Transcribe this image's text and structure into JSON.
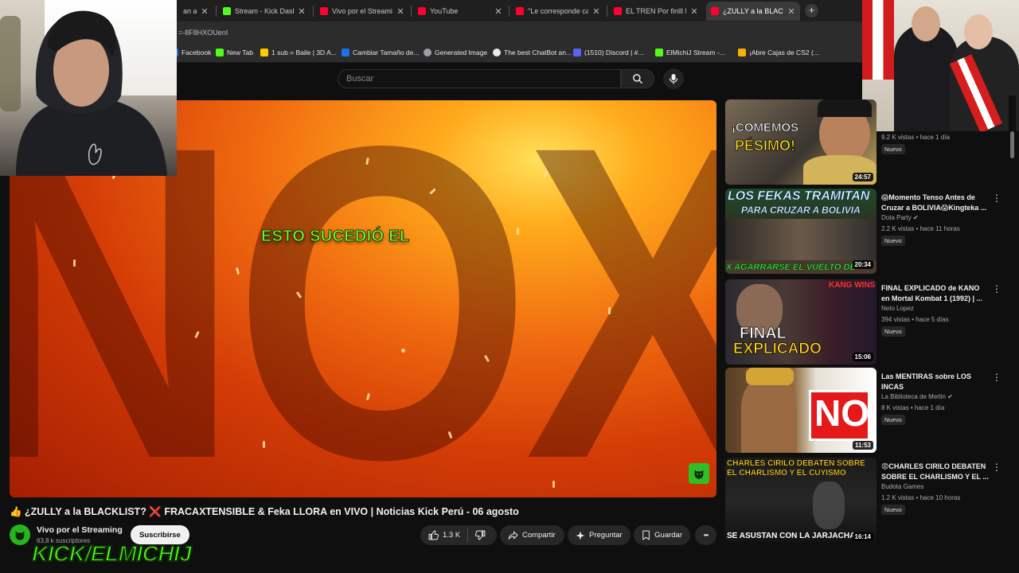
{
  "tabs": [
    {
      "label": "an a DI",
      "favicon_color": "#ff3333",
      "active": false
    },
    {
      "label": "Stream - Kick Dashbo",
      "favicon_color": "#53fc18",
      "active": false
    },
    {
      "label": "Vivo por el Streaming",
      "favicon_color": "#ff0033",
      "active": false
    },
    {
      "label": "YouTube",
      "favicon_color": "#ff0033",
      "active": false
    },
    {
      "label": "\"Le corresponde cad",
      "favicon_color": "#ff0033",
      "active": false
    },
    {
      "label": "EL TREN Por finlll Es",
      "favicon_color": "#ff0033",
      "active": false
    },
    {
      "label": "¿ZULLY a la BLAC",
      "favicon_color": "#ff0033",
      "active": true
    }
  ],
  "url_fragment": "=-8F8HXOUenI",
  "bookmarks": [
    {
      "label": "Facebook",
      "icon_color": "#1877f2"
    },
    {
      "label": "New Tab",
      "icon_color": "#53fc18"
    },
    {
      "label": "1 sub = Baile | 3D A...",
      "icon_color": "#ffcc00"
    },
    {
      "label": "Cambiar Tamaño de...",
      "icon_color": "#1a73e8"
    },
    {
      "label": "Generated Image",
      "icon_color": "#9aa0a6"
    },
    {
      "label": "The best ChatBot an...",
      "icon_color": "#e8eaed"
    },
    {
      "label": "(1510) Discord | #...",
      "icon_color": "#5865f2"
    },
    {
      "label": "ElMichiJ Stream -...",
      "icon_color": "#53fc18"
    },
    {
      "label": "¡Abre Cajas de CS2 (...",
      "icon_color": "#f4b400"
    }
  ],
  "search": {
    "placeholder": "Buscar"
  },
  "video": {
    "overlay_text": "ESTO SUCEDIÓ EL",
    "background_letters": "NOXE",
    "title": "👍 ¿ZULLY a la BLACKLIST? ❌ FRACAXTENSIBLE & Feka LLORA en VIVO | Noticias Kick Perú - 06 agosto"
  },
  "channel": {
    "name": "Vivo por el Streaming",
    "subscribers": "63,8 k suscriptores",
    "subscribe_label": "Suscribirse",
    "overlay_tag": "KICK/ELMICHIJ"
  },
  "actions": {
    "likes": "1.3 K",
    "share_label": "Compartir",
    "ask_label": "Preguntar",
    "save_label": "Guardar",
    "more_label": "•••"
  },
  "recommended": [
    {
      "thumb_text_1": "¡COMEMOS",
      "thumb_text_2": "PÉSIMO!",
      "duration": "24:57",
      "title": "",
      "channel": "",
      "meta": "9.2 K vistas • hace 1 día",
      "badge": "Nuevo"
    },
    {
      "thumb_text_1": "LOS FEKAS TRAMITAN",
      "thumb_text_2": "PARA CRUZAR A BOLIVIA",
      "thumb_text_3": "X AGARRARSE EL VUELTO DE",
      "duration": "20:34",
      "title": "😱Momento Tenso Antes de Cruzar a BOLIVIA😱Kingteka ...",
      "channel": "Dota Party ✔",
      "meta": "2.2 K vistas • hace 11 horas",
      "badge": "Nuevo"
    },
    {
      "thumb_text_1": "FINAL",
      "thumb_text_2": "EXPLICADO",
      "thumb_text_3": "KANG WINS",
      "duration": "15:06",
      "title": "FINAL EXPLICADO de KANO en Mortal Kombat 1 (1992) | ...",
      "channel": "Neto Lopez",
      "meta": "394 vistas • hace 5 días",
      "badge": "Nuevo"
    },
    {
      "thumb_text_1": "NO",
      "duration": "11:53",
      "title": "Las MENTIRAS sobre LOS INCAS",
      "channel": "La Biblioteca de Merlin ✔",
      "meta": "8 K vistas • hace 1 día",
      "badge": "Nuevo"
    },
    {
      "thumb_text_1": "CHARLES CIRILO DEBATEN SOBRE",
      "thumb_text_2": "EL CHARLISMO Y EL CUYISMO",
      "thumb_text_3": "SE ASUSTAN CON LA JARJACHA",
      "duration": "16:14",
      "title": "😡CHARLES CIRILO DEBATEN SOBRE EL CHARLISMO Y EL ...",
      "channel": "Budota Games",
      "meta": "1.2 K vistas • hace 10 horas",
      "badge": "Nuevo"
    }
  ],
  "colors": {
    "kick_green": "#53fc18",
    "overlay_green": "#8dff2c",
    "youtube_bg": "#0f0f0f",
    "video_orange": "#f06a10"
  }
}
